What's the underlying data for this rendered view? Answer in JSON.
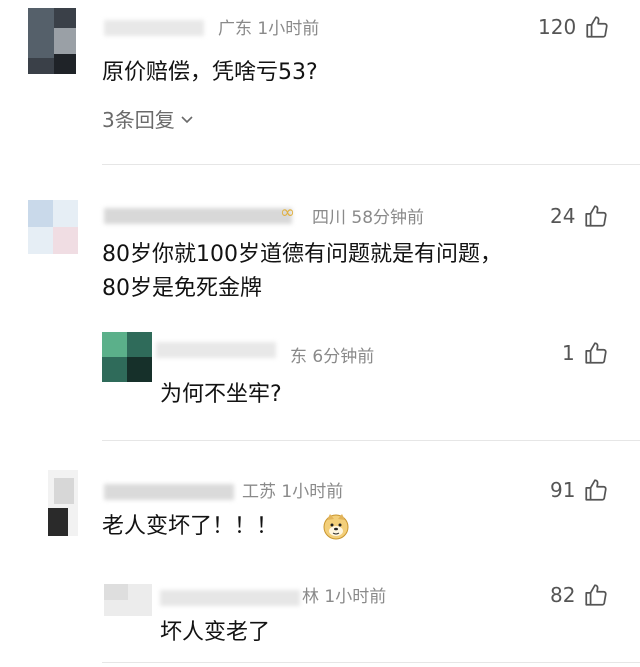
{
  "comments": [
    {
      "location_time": "广东 1小时前",
      "likes": "120",
      "text": "原价赔偿，凭啥亏53?",
      "replies_label": "3条回复"
    },
    {
      "location_time": "四川 58分钟前",
      "likes": "24",
      "text_line1": "80岁你就100岁道德有问题就是有问题，",
      "text_line2": "80岁是免死金牌"
    },
    {
      "location_time": "东 6分钟前",
      "likes": "1",
      "text": "为何不坐牢?"
    },
    {
      "location_time": "工苏 1小时前",
      "likes": "91",
      "text": "老人变坏了！！！"
    },
    {
      "location_time": "林 1小时前",
      "likes": "82",
      "text": "坏人变老了"
    }
  ],
  "icons": {
    "like": "thumbs-up-icon",
    "chevron": "chevron-down-icon",
    "emoji": "doge-emoji-icon"
  }
}
